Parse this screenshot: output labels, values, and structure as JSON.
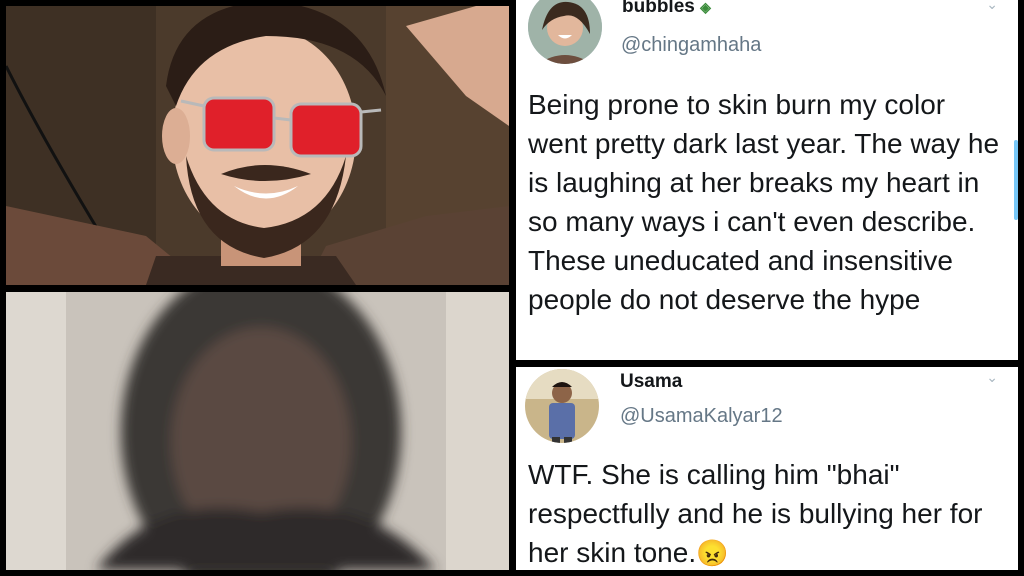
{
  "tweets": [
    {
      "display_name": "bubbles",
      "handle": "@chingamhaha",
      "text": "Being prone to skin burn my color went pretty dark last year. The way he is laughing at her breaks my heart in so many ways i can't even describe. These uneducated and insensitive people do not deserve the hype",
      "avatar_icon": "avatar-woman-smiling-icon",
      "badge_icon": "tag-emoji-icon",
      "menu_icon": "chevron-down-icon"
    },
    {
      "display_name": "Usama",
      "handle": "@UsamaKalyar12",
      "text": "WTF. She is calling him \"bhai\" respectfully and he is bullying her for her skin tone.",
      "emoji": "😠",
      "avatar_icon": "avatar-man-standing-icon",
      "menu_icon": "chevron-down-icon"
    }
  ],
  "colors": {
    "background": "#000000",
    "tweet_bg": "#ffffff",
    "text": "#14171a",
    "handle": "#657786",
    "scroll_accent": "#1da1f2",
    "glasses_red": "#e0202a"
  }
}
